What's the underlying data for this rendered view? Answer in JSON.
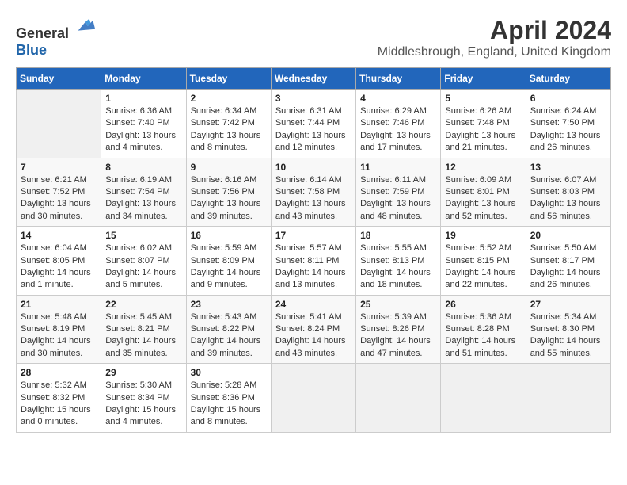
{
  "header": {
    "logo_general": "General",
    "logo_blue": "Blue",
    "month_title": "April 2024",
    "location": "Middlesbrough, England, United Kingdom"
  },
  "weekdays": [
    "Sunday",
    "Monday",
    "Tuesday",
    "Wednesday",
    "Thursday",
    "Friday",
    "Saturday"
  ],
  "weeks": [
    [
      {
        "day": "",
        "info": ""
      },
      {
        "day": "1",
        "info": "Sunrise: 6:36 AM\nSunset: 7:40 PM\nDaylight: 13 hours\nand 4 minutes."
      },
      {
        "day": "2",
        "info": "Sunrise: 6:34 AM\nSunset: 7:42 PM\nDaylight: 13 hours\nand 8 minutes."
      },
      {
        "day": "3",
        "info": "Sunrise: 6:31 AM\nSunset: 7:44 PM\nDaylight: 13 hours\nand 12 minutes."
      },
      {
        "day": "4",
        "info": "Sunrise: 6:29 AM\nSunset: 7:46 PM\nDaylight: 13 hours\nand 17 minutes."
      },
      {
        "day": "5",
        "info": "Sunrise: 6:26 AM\nSunset: 7:48 PM\nDaylight: 13 hours\nand 21 minutes."
      },
      {
        "day": "6",
        "info": "Sunrise: 6:24 AM\nSunset: 7:50 PM\nDaylight: 13 hours\nand 26 minutes."
      }
    ],
    [
      {
        "day": "7",
        "info": "Sunrise: 6:21 AM\nSunset: 7:52 PM\nDaylight: 13 hours\nand 30 minutes."
      },
      {
        "day": "8",
        "info": "Sunrise: 6:19 AM\nSunset: 7:54 PM\nDaylight: 13 hours\nand 34 minutes."
      },
      {
        "day": "9",
        "info": "Sunrise: 6:16 AM\nSunset: 7:56 PM\nDaylight: 13 hours\nand 39 minutes."
      },
      {
        "day": "10",
        "info": "Sunrise: 6:14 AM\nSunset: 7:58 PM\nDaylight: 13 hours\nand 43 minutes."
      },
      {
        "day": "11",
        "info": "Sunrise: 6:11 AM\nSunset: 7:59 PM\nDaylight: 13 hours\nand 48 minutes."
      },
      {
        "day": "12",
        "info": "Sunrise: 6:09 AM\nSunset: 8:01 PM\nDaylight: 13 hours\nand 52 minutes."
      },
      {
        "day": "13",
        "info": "Sunrise: 6:07 AM\nSunset: 8:03 PM\nDaylight: 13 hours\nand 56 minutes."
      }
    ],
    [
      {
        "day": "14",
        "info": "Sunrise: 6:04 AM\nSunset: 8:05 PM\nDaylight: 14 hours\nand 1 minute."
      },
      {
        "day": "15",
        "info": "Sunrise: 6:02 AM\nSunset: 8:07 PM\nDaylight: 14 hours\nand 5 minutes."
      },
      {
        "day": "16",
        "info": "Sunrise: 5:59 AM\nSunset: 8:09 PM\nDaylight: 14 hours\nand 9 minutes."
      },
      {
        "day": "17",
        "info": "Sunrise: 5:57 AM\nSunset: 8:11 PM\nDaylight: 14 hours\nand 13 minutes."
      },
      {
        "day": "18",
        "info": "Sunrise: 5:55 AM\nSunset: 8:13 PM\nDaylight: 14 hours\nand 18 minutes."
      },
      {
        "day": "19",
        "info": "Sunrise: 5:52 AM\nSunset: 8:15 PM\nDaylight: 14 hours\nand 22 minutes."
      },
      {
        "day": "20",
        "info": "Sunrise: 5:50 AM\nSunset: 8:17 PM\nDaylight: 14 hours\nand 26 minutes."
      }
    ],
    [
      {
        "day": "21",
        "info": "Sunrise: 5:48 AM\nSunset: 8:19 PM\nDaylight: 14 hours\nand 30 minutes."
      },
      {
        "day": "22",
        "info": "Sunrise: 5:45 AM\nSunset: 8:21 PM\nDaylight: 14 hours\nand 35 minutes."
      },
      {
        "day": "23",
        "info": "Sunrise: 5:43 AM\nSunset: 8:22 PM\nDaylight: 14 hours\nand 39 minutes."
      },
      {
        "day": "24",
        "info": "Sunrise: 5:41 AM\nSunset: 8:24 PM\nDaylight: 14 hours\nand 43 minutes."
      },
      {
        "day": "25",
        "info": "Sunrise: 5:39 AM\nSunset: 8:26 PM\nDaylight: 14 hours\nand 47 minutes."
      },
      {
        "day": "26",
        "info": "Sunrise: 5:36 AM\nSunset: 8:28 PM\nDaylight: 14 hours\nand 51 minutes."
      },
      {
        "day": "27",
        "info": "Sunrise: 5:34 AM\nSunset: 8:30 PM\nDaylight: 14 hours\nand 55 minutes."
      }
    ],
    [
      {
        "day": "28",
        "info": "Sunrise: 5:32 AM\nSunset: 8:32 PM\nDaylight: 15 hours\nand 0 minutes."
      },
      {
        "day": "29",
        "info": "Sunrise: 5:30 AM\nSunset: 8:34 PM\nDaylight: 15 hours\nand 4 minutes."
      },
      {
        "day": "30",
        "info": "Sunrise: 5:28 AM\nSunset: 8:36 PM\nDaylight: 15 hours\nand 8 minutes."
      },
      {
        "day": "",
        "info": ""
      },
      {
        "day": "",
        "info": ""
      },
      {
        "day": "",
        "info": ""
      },
      {
        "day": "",
        "info": ""
      }
    ]
  ]
}
